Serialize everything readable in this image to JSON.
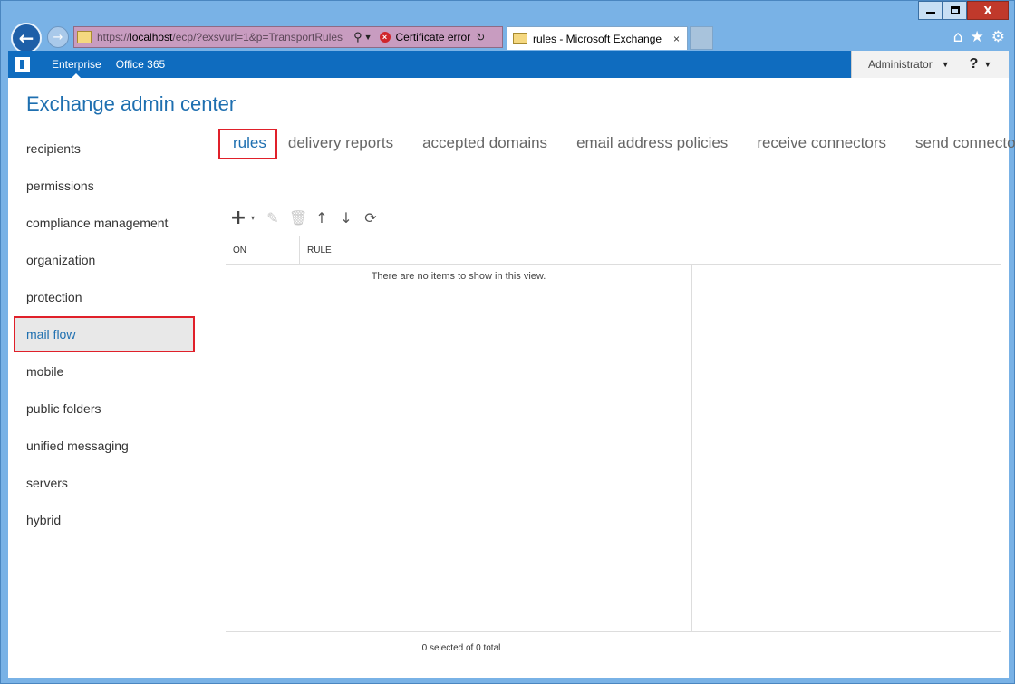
{
  "browser": {
    "url_prefix": "https://",
    "url_host": "localhost",
    "url_path": "/ecp/?exsvurl=1&p=TransportRules",
    "certificate_error": "Certificate error",
    "tab_title": "rules - Microsoft Exchange",
    "tab_close": "×",
    "window_minimize": "",
    "window_close": "X"
  },
  "topbar": {
    "links": [
      "Enterprise",
      "Office 365"
    ],
    "user": "Administrator",
    "help": "?"
  },
  "app": {
    "title": "Exchange admin center"
  },
  "sidebar": {
    "items": [
      {
        "label": "recipients"
      },
      {
        "label": "permissions"
      },
      {
        "label": "compliance management"
      },
      {
        "label": "organization"
      },
      {
        "label": "protection"
      },
      {
        "label": "mail flow",
        "selected": true
      },
      {
        "label": "mobile"
      },
      {
        "label": "public folders"
      },
      {
        "label": "unified messaging"
      },
      {
        "label": "servers"
      },
      {
        "label": "hybrid"
      }
    ]
  },
  "subnav": {
    "tabs": [
      "rules",
      "delivery reports",
      "accepted domains",
      "email address policies",
      "receive connectors",
      "send connectors"
    ],
    "active": "rules"
  },
  "toolbar": {
    "add": "+",
    "caret": "▾",
    "edit": "✎",
    "delete": "🗑",
    "up": "↑",
    "down": "↓",
    "refresh": "⟳"
  },
  "grid": {
    "columns": [
      "ON",
      "RULE"
    ],
    "empty_message": "There are no items to show in this view.",
    "footer": "0 selected of 0 total"
  },
  "colors": {
    "accent": "#1e6fb0",
    "topbar": "#0f6cbf",
    "highlight": "#e0202a"
  }
}
